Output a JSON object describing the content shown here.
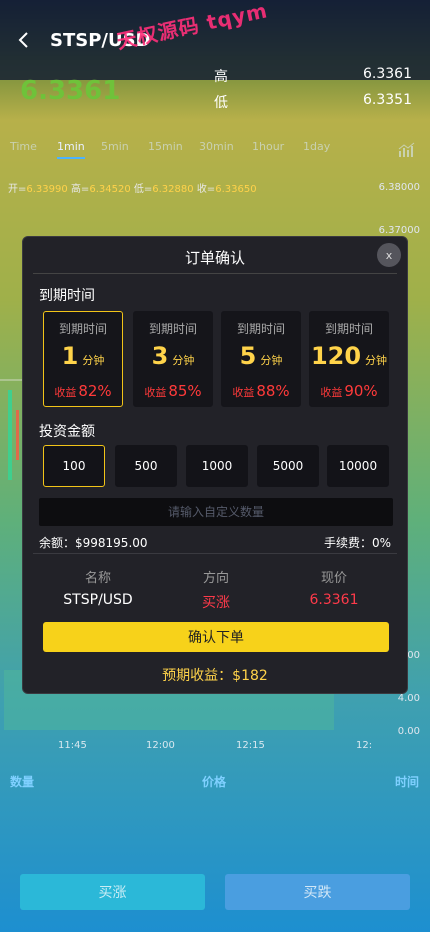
{
  "header": {
    "title": "STSP/USD",
    "watermark": "天权源码 tqym"
  },
  "price_panel": {
    "current_price": "6.3361",
    "high_label": "高",
    "high_value": "6.3361",
    "low_label": "低",
    "low_value": "6.3351"
  },
  "time_tabs": [
    "Time",
    "1min",
    "5min",
    "15min",
    "30min",
    "1hour",
    "1day"
  ],
  "ohlc": {
    "open_label": "开=",
    "open": "6.33990",
    "high_label": "高=",
    "high": "6.34520",
    "low_label": "低=",
    "low": "6.32880",
    "close_label": "收=",
    "close": "6.33650"
  },
  "y_axis": [
    "6.38000",
    "6.37000",
    "6.00",
    "4.00",
    "0.00"
  ],
  "x_axis": [
    "11:45",
    "12:00",
    "12:15",
    "12:"
  ],
  "orderbook": {
    "qty": "数量",
    "price": "价格",
    "time": "时间"
  },
  "bottom_buttons": {
    "buy_up": "买涨",
    "buy_down": "买跌"
  },
  "modal": {
    "title": "订单确认",
    "close": "x",
    "expiry_label": "到期时间",
    "durations": [
      {
        "label": "到期时间",
        "value": "1",
        "unit": "分钟",
        "yield_label": "收益",
        "yield": "82%",
        "selected": true
      },
      {
        "label": "到期时间",
        "value": "3",
        "unit": "分钟",
        "yield_label": "收益",
        "yield": "85%",
        "selected": false
      },
      {
        "label": "到期时间",
        "value": "5",
        "unit": "分钟",
        "yield_label": "收益",
        "yield": "88%",
        "selected": false
      },
      {
        "label": "到期时间",
        "value": "120",
        "unit": "分钟",
        "yield_label": "收益",
        "yield": "90%",
        "selected": false
      }
    ],
    "amount_label": "投资金额",
    "amounts": [
      "100",
      "500",
      "1000",
      "5000",
      "10000"
    ],
    "custom_placeholder": "请输入自定义数量",
    "balance": "余额：$998195.00",
    "fee": "手续费：0%",
    "info": [
      {
        "label": "名称",
        "value": "STSP/USD"
      },
      {
        "label": "方向",
        "value": "买涨"
      },
      {
        "label": "现价",
        "value": "6.3361"
      }
    ],
    "confirm": "确认下单",
    "expected": "预期收益：$182"
  },
  "colors": {
    "accent_yellow": "#f7d21a",
    "price_green": "#6fc23a",
    "up_red": "#ff3a4a",
    "tab_blue": "#4bb3ff"
  }
}
